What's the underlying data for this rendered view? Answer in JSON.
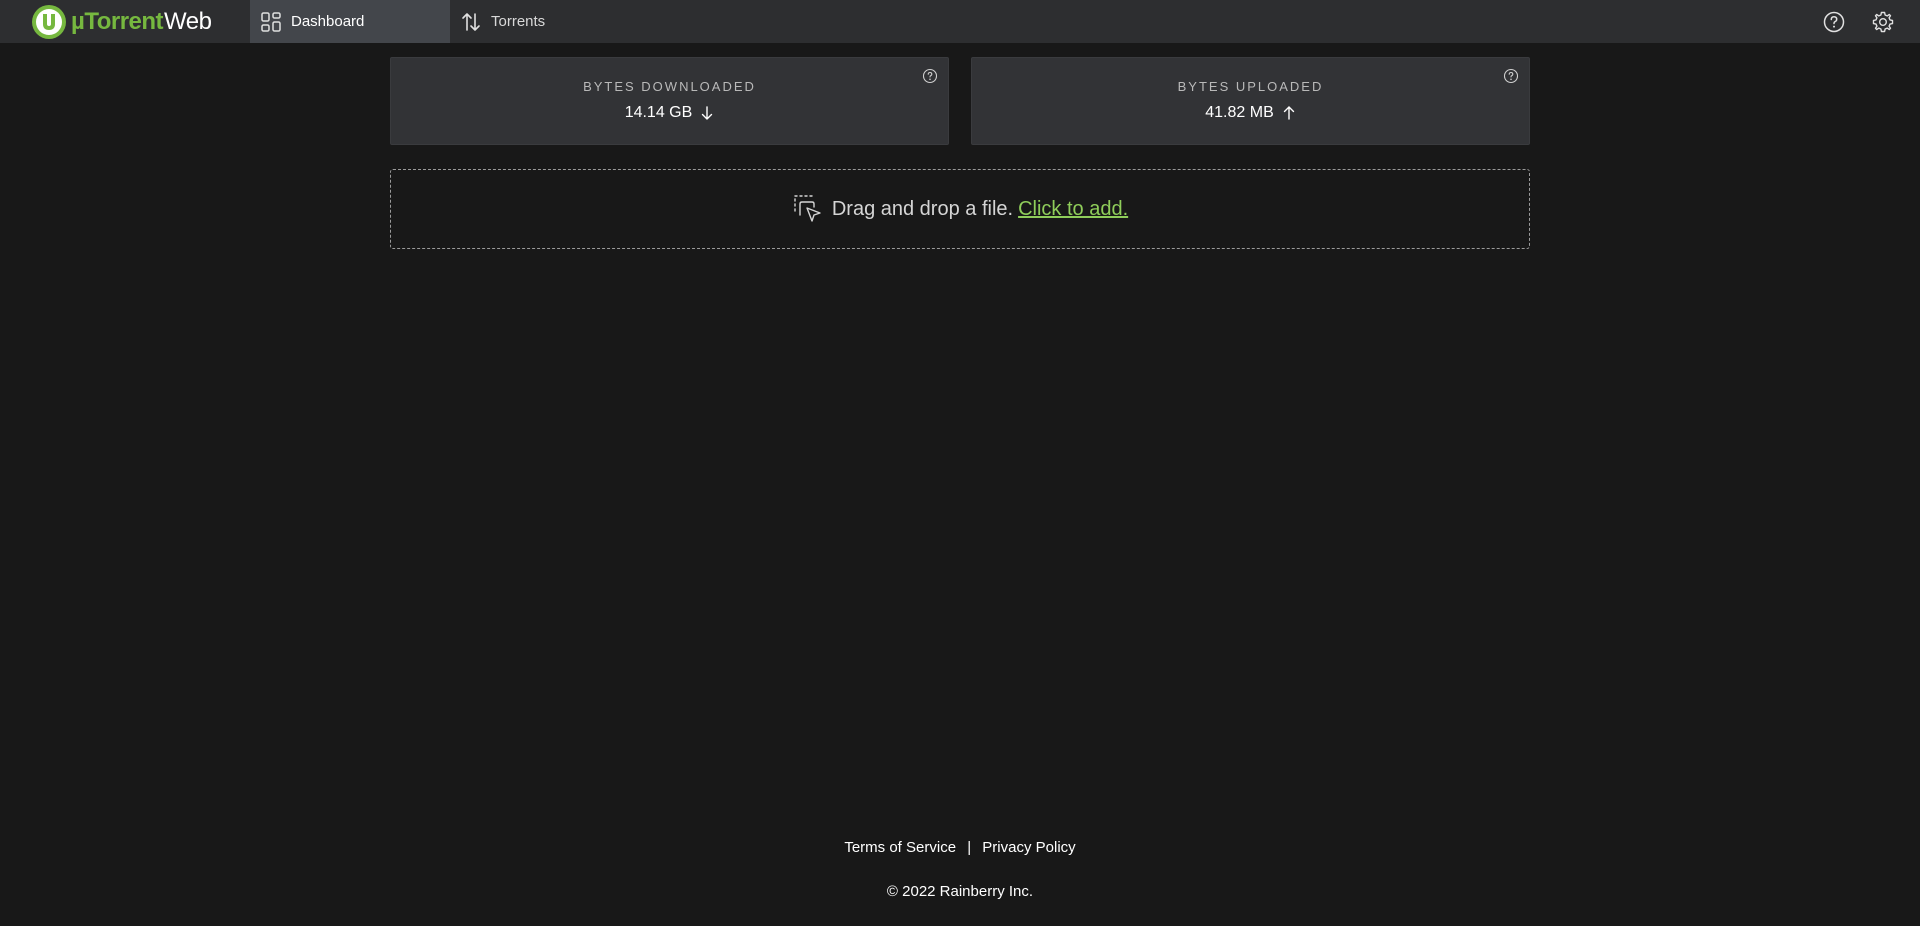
{
  "app": {
    "brand": "µTorrent",
    "brand_suffix": "Web"
  },
  "nav": {
    "tabs": [
      {
        "label": "Dashboard",
        "icon": "dashboard-grid-icon",
        "active": true
      },
      {
        "label": "Torrents",
        "icon": "transfer-arrows-icon",
        "active": false
      }
    ]
  },
  "topbar_icons": [
    "help-circle-icon",
    "settings-gear-icon"
  ],
  "stats": {
    "downloaded": {
      "label": "BYTES DOWNLOADED",
      "value": "14.14 GB",
      "icon": "arrow-down-icon"
    },
    "uploaded": {
      "label": "BYTES UPLOADED",
      "value": "41.82 MB",
      "icon": "arrow-up-icon"
    }
  },
  "dropzone": {
    "text": "Drag and drop a file.",
    "link": "Click to add.",
    "icon": "drag-drop-pointer-icon"
  },
  "footer": {
    "terms": "Terms of Service",
    "separator": "|",
    "privacy": "Privacy Policy",
    "copyright": "© 2022 Rainberry Inc."
  },
  "colors": {
    "background": "#181818",
    "topbar": "#2d2e30",
    "active_tab": "#43464b",
    "card": "#323336",
    "brand_green": "#76b83f",
    "link_green": "#8fcd5a"
  }
}
